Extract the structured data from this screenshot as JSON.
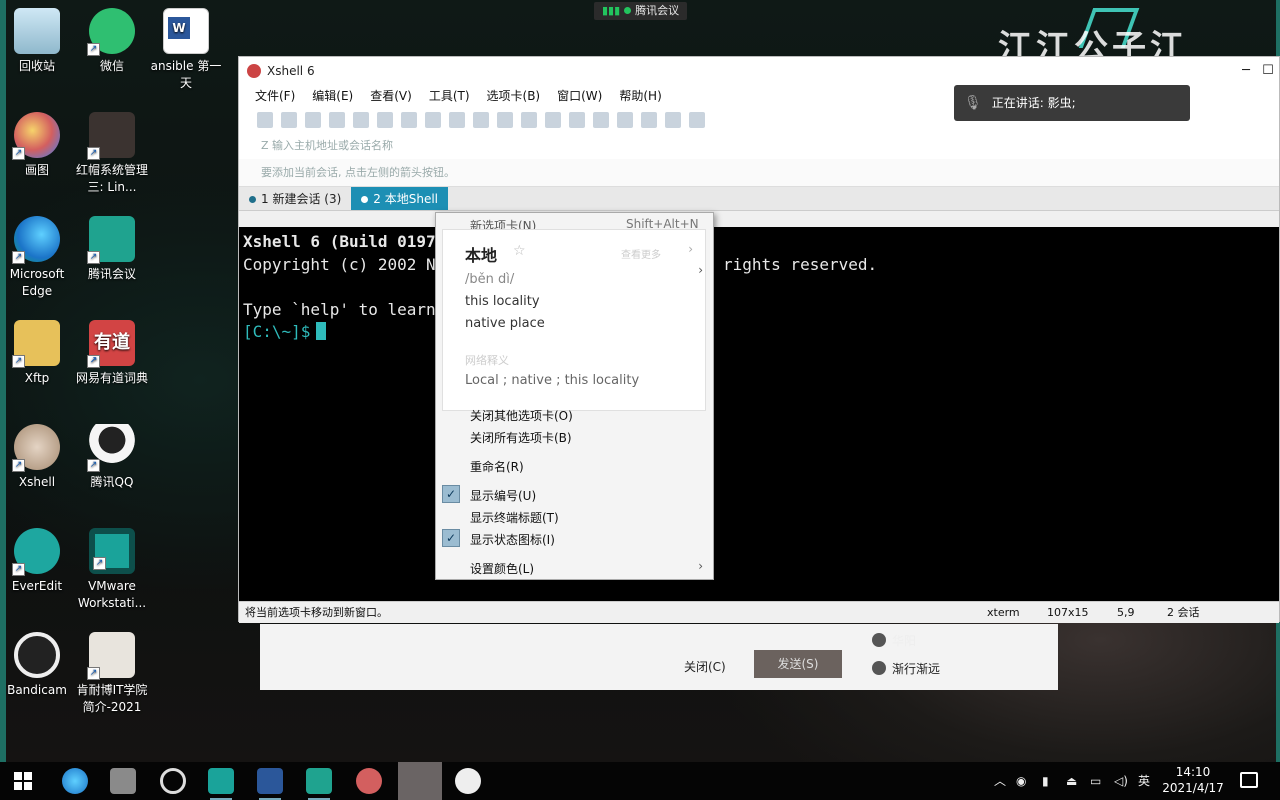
{
  "desktop": {
    "icons": [
      {
        "label": "回收站",
        "icon": "recycle-bin-icon"
      },
      {
        "label": "微信",
        "icon": "wechat-icon"
      },
      {
        "label": "ansible 第一天",
        "icon": "word-doc-icon"
      },
      {
        "label": "画图",
        "icon": "paint-icon"
      },
      {
        "label": "红帽系统管理三: Lin...",
        "icon": "book-icon"
      },
      {
        "label": "Microsoft Edge",
        "icon": "edge-icon"
      },
      {
        "label": "腾讯会议",
        "icon": "tencent-meeting-icon"
      },
      {
        "label": "Xftp",
        "icon": "xftp-icon"
      },
      {
        "label": "网易有道词典",
        "icon": "youdao-icon"
      },
      {
        "label": "Xshell",
        "icon": "xshell-icon"
      },
      {
        "label": "腾讯QQ",
        "icon": "qq-icon"
      },
      {
        "label": "EverEdit",
        "icon": "everedit-icon"
      },
      {
        "label": "VMware Workstati...",
        "icon": "vmware-icon"
      },
      {
        "label": "Bandicam",
        "icon": "bandicam-icon"
      },
      {
        "label": "肯耐博IT学院简介-2021",
        "icon": "image-file-icon"
      }
    ],
    "meeting_top_label": "腾讯会议",
    "speaking_label": "正在讲话: 影虫;",
    "watermark_text": "江江公子江"
  },
  "xshell": {
    "title": "Xshell 6",
    "menu": [
      "文件(F)",
      "编辑(E)",
      "查看(V)",
      "工具(T)",
      "选项卡(B)",
      "窗口(W)",
      "帮助(H)"
    ],
    "address_placeholder": "Z 输入主机地址或会话名称",
    "hint_text": "要添加当前会话, 点击左侧的箭头按钮。",
    "tabs": [
      {
        "label": "1 新建会话 (3)"
      },
      {
        "label": "2 本地Shell"
      }
    ],
    "terminal": {
      "line1": "Xshell 6 (Build 0197",
      "line2": "Copyright (c) 2002 N",
      "line2_tail": "rights reserved.",
      "line3": "Type `help' to learn",
      "prompt": "[C:\\~]$"
    },
    "status": {
      "left": "将当前选项卡移动到新窗口。",
      "term": "xterm",
      "size": "107x15",
      "pos": "5,9",
      "sessions": "2 会话"
    }
  },
  "context_menu": {
    "top_item": "新选项卡(N)",
    "top_shortcut": "Shift+Alt+N",
    "dict": {
      "word": "本地",
      "pron": "/běn dì/",
      "def1": "this locality",
      "def2": "native place",
      "net_label": "网络释义",
      "net": "Local ; native ; this locality",
      "side_label": "查看更多"
    },
    "items": [
      {
        "label": "关闭其他选项卡(O)",
        "checked": false
      },
      {
        "label": "关闭所有选项卡(B)",
        "checked": false
      },
      {
        "label": "重命名(R)",
        "checked": false
      },
      {
        "label": "显示编号(U)",
        "checked": true
      },
      {
        "label": "显示终端标题(T)",
        "checked": false
      },
      {
        "label": "显示状态图标(I)",
        "checked": true
      },
      {
        "label": "设置颜色(L)",
        "checked": false
      }
    ]
  },
  "meeting_panel": {
    "close_label": "关闭(C)",
    "send_label": "发送(S)",
    "users": [
      "华阳",
      "渐行渐远"
    ]
  },
  "taskbar": {
    "ime": "英",
    "time": "14:10",
    "date": "2021/4/17"
  },
  "colors": {
    "tab_active": "#1d8fb4",
    "terminal_bg": "#000000",
    "prompt": "#2fbbbb",
    "accent": "#1e6f63"
  }
}
